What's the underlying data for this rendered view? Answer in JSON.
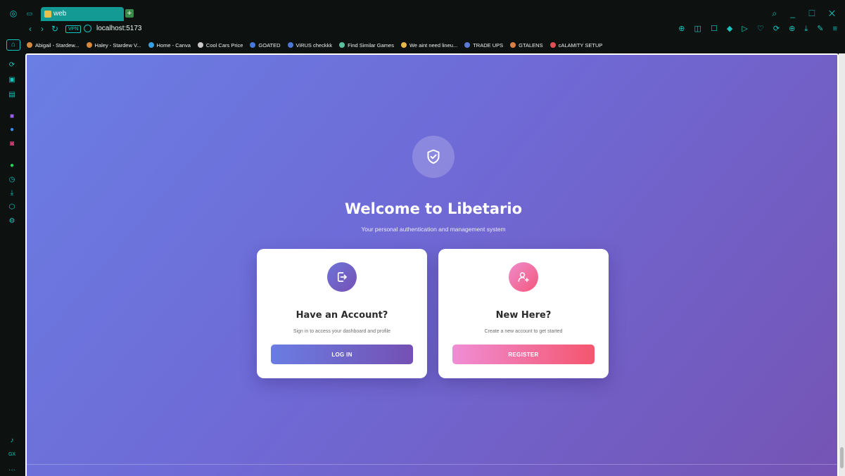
{
  "browser": {
    "tab_title": "web",
    "url": "localhost:5173",
    "vpn_label": "VPN",
    "accent": "#16c5be",
    "bookmarks": [
      {
        "label": "Abigail - Stardew...",
        "color": "#d48a3a"
      },
      {
        "label": "Haley - Stardew V...",
        "color": "#d48a3a"
      },
      {
        "label": "Home - Canva",
        "color": "#3aa0e0"
      },
      {
        "label": "Cool Cars Price",
        "color": "#c9c9c9"
      },
      {
        "label": "GOATED",
        "color": "#4a78d8"
      },
      {
        "label": "ViRUS checkkk",
        "color": "#4a78d8"
      },
      {
        "label": "Find Similar Games",
        "color": "#5cc0a0"
      },
      {
        "label": "We aint need lineu...",
        "color": "#e6b84a"
      },
      {
        "label": "TRADE UPS",
        "color": "#5a7ad8"
      },
      {
        "label": "GTALENS",
        "color": "#e08040"
      },
      {
        "label": "cALAMITY SETUP",
        "color": "#e05050"
      }
    ]
  },
  "page": {
    "title": "Welcome to Libetario",
    "subtitle": "Your personal authentication and management system",
    "icon": "shield-check-icon",
    "gradient": [
      "#6a7ee3",
      "#7554b4"
    ]
  },
  "cards": {
    "login": {
      "icon": "login-icon",
      "title": "Have an Account?",
      "description": "Sign in to access your dashboard and profile",
      "button": "LOG IN"
    },
    "register": {
      "icon": "user-plus-icon",
      "title": "New Here?",
      "description": "Create a new account to get started",
      "button": "REGISTER"
    }
  },
  "sidebar": {
    "icons": [
      "refresh-icon",
      "chat-icon",
      "news-icon",
      "twitch-icon",
      "messenger-icon",
      "instagram-icon",
      "spotify-icon",
      "history-icon",
      "download-icon",
      "extensions-icon",
      "settings-icon",
      "music-icon",
      "gx-icon",
      "more-icon"
    ]
  }
}
